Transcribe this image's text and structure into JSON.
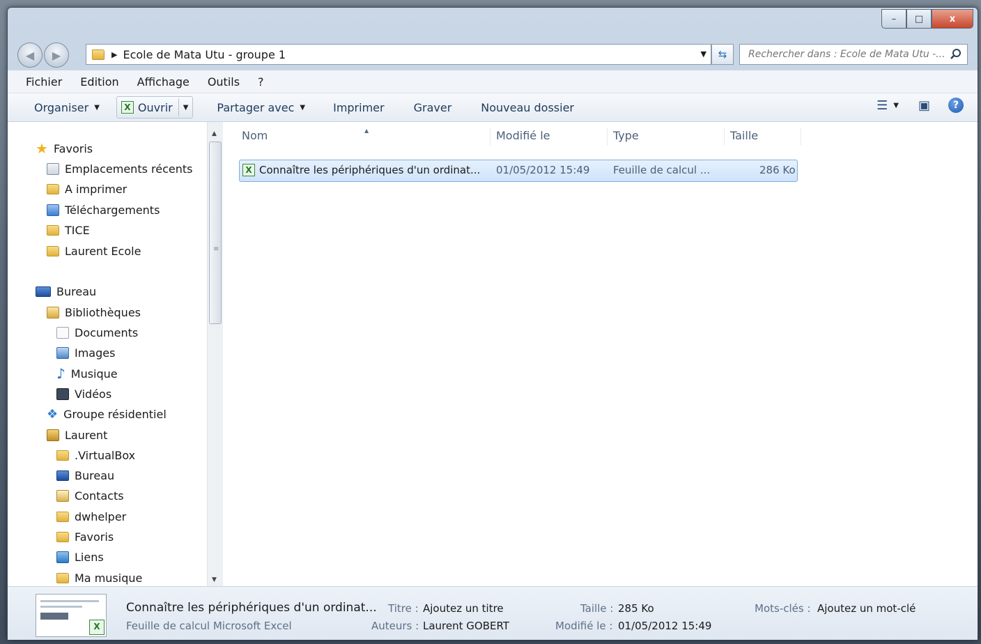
{
  "window": {
    "min_glyph": "–",
    "max_glyph": "□",
    "close_glyph": "x"
  },
  "address": {
    "path": "Ecole de Mata Utu - groupe 1"
  },
  "search": {
    "placeholder": "Rechercher dans : Ecole de Mata Utu -...",
    "icon": "search-icon"
  },
  "menubar": [
    "Fichier",
    "Edition",
    "Affichage",
    "Outils",
    "?"
  ],
  "toolbar": {
    "organiser": "Organiser",
    "ouvrir": "Ouvrir",
    "partager": "Partager avec",
    "imprimer": "Imprimer",
    "graver": "Graver",
    "nouveau_dossier": "Nouveau dossier"
  },
  "navpane": {
    "favoris": "Favoris",
    "emplacements": "Emplacements récents",
    "a_imprimer": "A imprimer",
    "telechargements": "Téléchargements",
    "tice": "TICE",
    "laurent_ecole": "Laurent Ecole",
    "bureau": "Bureau",
    "bibliotheques": "Bibliothèques",
    "documents": "Documents",
    "images": "Images",
    "musique": "Musique",
    "videos": "Vidéos",
    "groupe": "Groupe résidentiel",
    "laurent": "Laurent",
    "virtualbox": ".VirtualBox",
    "bureau2": "Bureau",
    "contacts": "Contacts",
    "dwhelper": "dwhelper",
    "favoris2": "Favoris",
    "liens": "Liens",
    "ma_musique": "Ma musique"
  },
  "columns": {
    "name": "Nom",
    "modified": "Modifié le",
    "type": "Type",
    "size": "Taille"
  },
  "file": {
    "name": "Connaître les périphériques d'un ordinat...",
    "modified": "01/05/2012 15:49",
    "type": "Feuille de calcul ...",
    "size": "286 Ko"
  },
  "details": {
    "file_name": "Connaître les périphériques d'un ordinat...",
    "file_type": "Feuille de calcul Microsoft Excel",
    "titre_label": "Titre :",
    "titre_value": "Ajoutez un titre",
    "auteurs_label": "Auteurs :",
    "auteurs_value": "Laurent GOBERT",
    "taille_label": "Taille :",
    "taille_value": "285 Ko",
    "modifie_label": "Modifié le :",
    "modifie_value": "01/05/2012 15:49",
    "mots_label": "Mots-clés :",
    "mots_value": "Ajoutez un mot-clé"
  }
}
